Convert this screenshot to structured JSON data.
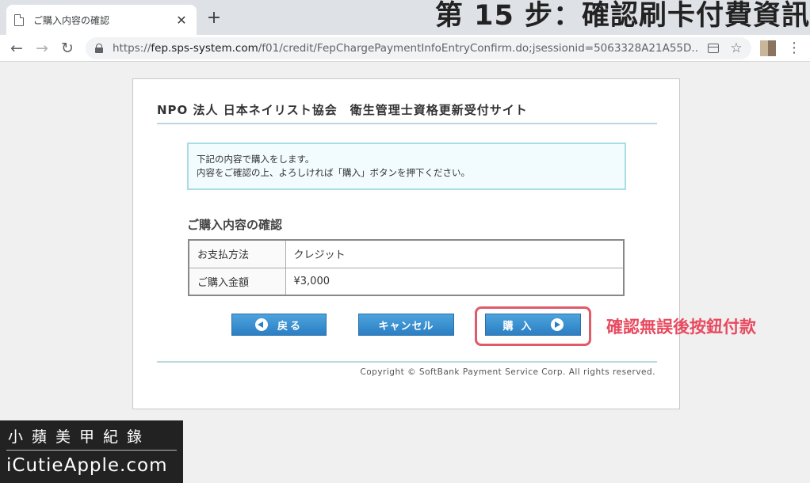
{
  "browser": {
    "tab_title": "ご購入内容の確認",
    "tab_close": "✕",
    "new_tab": "+",
    "back": "←",
    "forward": "→",
    "reload": "↻",
    "url_prefix": "https://",
    "url_host": "fep.sps-system.com",
    "url_path": "/f01/credit/FepChargePaymentInfoEntryConfirm.do;jsessionid=5063328A21A55D...",
    "star": "☆",
    "menu": "⋮"
  },
  "overlay_title": "第 15 步：確認刷卡付費資訊",
  "page": {
    "site_title": "NPO 法人 日本ネイリスト協会　衛生管理士資格更新受付サイト",
    "notice_line1": "下記の内容で購入をします。",
    "notice_line2": "内容をご確認の上、よろしければ「購入」ボタンを押下ください。",
    "section_heading": "ご購入内容の確認",
    "table": [
      {
        "label": "お支払方法",
        "value": "クレジット"
      },
      {
        "label": "ご購入金額",
        "value": "¥3,000"
      }
    ],
    "buttons": {
      "back": "戻る",
      "cancel": "キャンセル",
      "purchase": "購入"
    },
    "annotation": "確認無誤後按鈕付款",
    "copyright": "Copyright © SoftBank Payment Service Corp. All rights reserved."
  },
  "watermark": {
    "line1": "小蘋美甲紀錄",
    "line2": "iCutieApple.com"
  },
  "colors": {
    "button_blue": "#2b7fc3",
    "notice_bg": "#f2fbfd",
    "notice_border": "#a9dde5",
    "highlight": "#e15a6a",
    "annotation": "#e84a5f"
  }
}
